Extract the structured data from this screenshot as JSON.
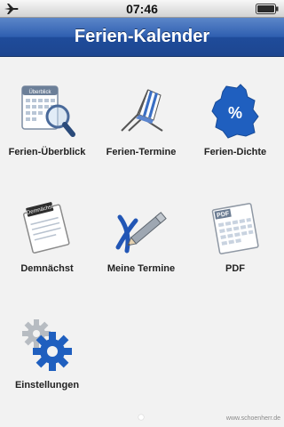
{
  "statusbar": {
    "time": "07:46",
    "left_icon": "airplane-icon",
    "right_icon": "battery-icon"
  },
  "navbar": {
    "title": "Ferien-Kalender"
  },
  "tiles": [
    {
      "label": "Ferien-Überblick",
      "icon": "calendar-magnifier-icon",
      "badge": "Überblick"
    },
    {
      "label": "Ferien-Termine",
      "icon": "beach-chair-icon"
    },
    {
      "label": "Ferien-Dichte",
      "icon": "germany-map-percent-icon",
      "badge": "%"
    },
    {
      "label": "Demnächst",
      "icon": "notepad-icon",
      "badge": "Demnächst"
    },
    {
      "label": "Meine Termine",
      "icon": "pencil-cross-icon"
    },
    {
      "label": "PDF",
      "icon": "pdf-document-icon",
      "badge": "PDF"
    },
    {
      "label": "Einstellungen",
      "icon": "gears-icon"
    }
  ],
  "footer": {
    "url": "www.schoenherr.de"
  },
  "colors": {
    "nav_blue": "#2f5fb0",
    "background": "#f2f2f2",
    "icon_blue": "#1f5fbf"
  }
}
